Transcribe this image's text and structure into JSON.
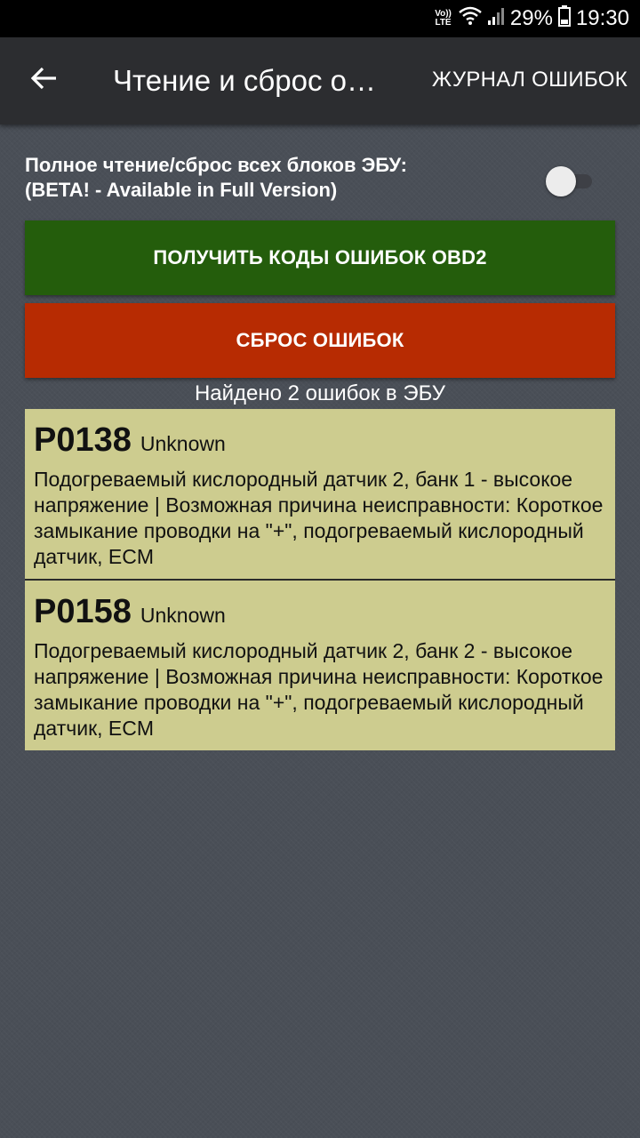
{
  "status_bar": {
    "volte_top": "Vo))",
    "volte_bottom": "LTE",
    "battery": "29%",
    "time": "19:30",
    "icons": [
      "wifi-icon",
      "signal-icon",
      "battery-icon"
    ]
  },
  "app_bar": {
    "back_icon": "arrow-left-icon",
    "title": "Чтение и сброс ошибок",
    "journal_button": "ЖУРНАЛ ОШИБОК"
  },
  "toggle": {
    "label_line1": "Полное чтение/сброс всех блоков ЭБУ:",
    "label_line2": "(BETA! - Available in Full Version)",
    "enabled": false
  },
  "buttons": {
    "get_codes": "ПОЛУЧИТЬ КОДЫ ОШИБОК OBD2",
    "reset": "СБРОС ОШИБОК"
  },
  "colors": {
    "get_codes_button": "#245d0c",
    "reset_button": "#b72b02",
    "error_card": "#cdcc8f"
  },
  "found_text": "Найдено 2 ошибок в ЭБУ",
  "errors": [
    {
      "code": "P0138",
      "status": "Unknown",
      "description": "Подогреваемый кислородный датчик 2, банк 1 - высокое напряжение | Возможная причина неисправности: Короткое замыкание проводки на \"+\", подогреваемый кислородный датчик, ECM"
    },
    {
      "code": "P0158",
      "status": "Unknown",
      "description": "Подогреваемый кислородный датчик 2, банк 2 - высокое напряжение | Возможная причина неисправности: Короткое замыкание проводки на \"+\", подогреваемый кислородный датчик, ECM"
    }
  ]
}
